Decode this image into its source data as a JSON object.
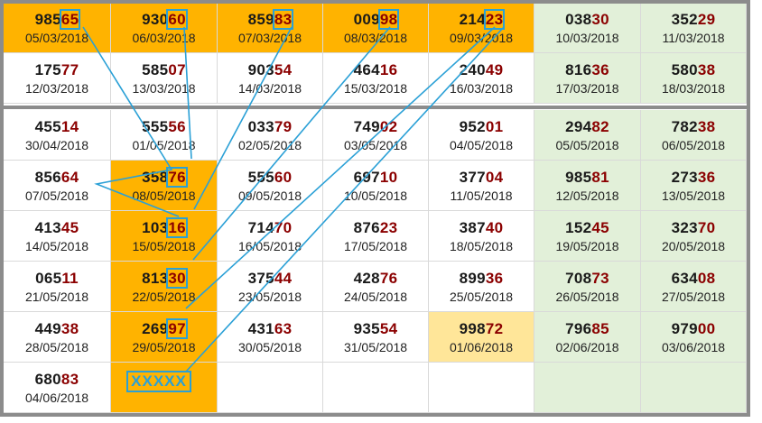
{
  "colors": {
    "orange": "#ffb300",
    "green": "#e2f0d9",
    "cream": "#ffe699",
    "white": "#ffffff",
    "highlight_digits": "#8b0000",
    "connector": "#2aa0d6"
  },
  "placeholder_label": "XXXXX",
  "top_rows": [
    [
      {
        "main": "985",
        "hi": "65",
        "date": "05/03/2018",
        "bg": "orange",
        "boxed": true
      },
      {
        "main": "930",
        "hi": "60",
        "date": "06/03/2018",
        "bg": "orange",
        "boxed": true
      },
      {
        "main": "859",
        "hi": "83",
        "date": "07/03/2018",
        "bg": "orange",
        "boxed": true
      },
      {
        "main": "009",
        "hi": "98",
        "date": "08/03/2018",
        "bg": "orange",
        "boxed": true
      },
      {
        "main": "214",
        "hi": "23",
        "date": "09/03/2018",
        "bg": "orange",
        "boxed": true
      },
      {
        "main": "038",
        "hi": "30",
        "date": "10/03/2018",
        "bg": "green",
        "boxed": false
      },
      {
        "main": "352",
        "hi": "29",
        "date": "11/03/2018",
        "bg": "green",
        "boxed": false
      }
    ],
    [
      {
        "main": "175",
        "hi": "77",
        "date": "12/03/2018",
        "bg": "white",
        "boxed": false
      },
      {
        "main": "585",
        "hi": "07",
        "date": "13/03/2018",
        "bg": "white",
        "boxed": false
      },
      {
        "main": "903",
        "hi": "54",
        "date": "14/03/2018",
        "bg": "white",
        "boxed": false
      },
      {
        "main": "464",
        "hi": "16",
        "date": "15/03/2018",
        "bg": "white",
        "boxed": false
      },
      {
        "main": "240",
        "hi": "49",
        "date": "16/03/2018",
        "bg": "white",
        "boxed": false
      },
      {
        "main": "816",
        "hi": "36",
        "date": "17/03/2018",
        "bg": "green",
        "boxed": false
      },
      {
        "main": "580",
        "hi": "38",
        "date": "18/03/2018",
        "bg": "green",
        "boxed": false
      }
    ]
  ],
  "bottom_rows": [
    [
      {
        "main": "455",
        "hi": "14",
        "date": "30/04/2018",
        "bg": "white",
        "boxed": false
      },
      {
        "main": "555",
        "hi": "56",
        "date": "01/05/2018",
        "bg": "white",
        "boxed": false
      },
      {
        "main": "033",
        "hi": "79",
        "date": "02/05/2018",
        "bg": "white",
        "boxed": false
      },
      {
        "main": "749",
        "hi": "02",
        "date": "03/05/2018",
        "bg": "white",
        "boxed": false
      },
      {
        "main": "952",
        "hi": "01",
        "date": "04/05/2018",
        "bg": "white",
        "boxed": false
      },
      {
        "main": "294",
        "hi": "82",
        "date": "05/05/2018",
        "bg": "green",
        "boxed": false
      },
      {
        "main": "782",
        "hi": "38",
        "date": "06/05/2018",
        "bg": "green",
        "boxed": false
      }
    ],
    [
      {
        "main": "856",
        "hi": "64",
        "date": "07/05/2018",
        "bg": "white",
        "boxed": false
      },
      {
        "main": "358",
        "hi": "76",
        "date": "08/05/2018",
        "bg": "orange",
        "boxed": true
      },
      {
        "main": "555",
        "hi": "60",
        "date": "09/05/2018",
        "bg": "white",
        "boxed": false
      },
      {
        "main": "697",
        "hi": "10",
        "date": "10/05/2018",
        "bg": "white",
        "boxed": false
      },
      {
        "main": "377",
        "hi": "04",
        "date": "11/05/2018",
        "bg": "white",
        "boxed": false
      },
      {
        "main": "985",
        "hi": "81",
        "date": "12/05/2018",
        "bg": "green",
        "boxed": false
      },
      {
        "main": "273",
        "hi": "36",
        "date": "13/05/2018",
        "bg": "green",
        "boxed": false
      }
    ],
    [
      {
        "main": "413",
        "hi": "45",
        "date": "14/05/2018",
        "bg": "white",
        "boxed": false
      },
      {
        "main": "103",
        "hi": "16",
        "date": "15/05/2018",
        "bg": "orange",
        "boxed": true
      },
      {
        "main": "714",
        "hi": "70",
        "date": "16/05/2018",
        "bg": "white",
        "boxed": false
      },
      {
        "main": "876",
        "hi": "23",
        "date": "17/05/2018",
        "bg": "white",
        "boxed": false
      },
      {
        "main": "387",
        "hi": "40",
        "date": "18/05/2018",
        "bg": "white",
        "boxed": false
      },
      {
        "main": "152",
        "hi": "45",
        "date": "19/05/2018",
        "bg": "green",
        "boxed": false
      },
      {
        "main": "323",
        "hi": "70",
        "date": "20/05/2018",
        "bg": "green",
        "boxed": false
      }
    ],
    [
      {
        "main": "065",
        "hi": "11",
        "date": "21/05/2018",
        "bg": "white",
        "boxed": false
      },
      {
        "main": "813",
        "hi": "30",
        "date": "22/05/2018",
        "bg": "orange",
        "boxed": true
      },
      {
        "main": "375",
        "hi": "44",
        "date": "23/05/2018",
        "bg": "white",
        "boxed": false
      },
      {
        "main": "428",
        "hi": "76",
        "date": "24/05/2018",
        "bg": "white",
        "boxed": false
      },
      {
        "main": "899",
        "hi": "36",
        "date": "25/05/2018",
        "bg": "white",
        "boxed": false
      },
      {
        "main": "708",
        "hi": "73",
        "date": "26/05/2018",
        "bg": "green",
        "boxed": false
      },
      {
        "main": "634",
        "hi": "08",
        "date": "27/05/2018",
        "bg": "green",
        "boxed": false
      }
    ],
    [
      {
        "main": "449",
        "hi": "38",
        "date": "28/05/2018",
        "bg": "white",
        "boxed": false
      },
      {
        "main": "269",
        "hi": "97",
        "date": "29/05/2018",
        "bg": "orange",
        "boxed": true
      },
      {
        "main": "431",
        "hi": "63",
        "date": "30/05/2018",
        "bg": "white",
        "boxed": false
      },
      {
        "main": "935",
        "hi": "54",
        "date": "31/05/2018",
        "bg": "white",
        "boxed": false
      },
      {
        "main": "998",
        "hi": "72",
        "date": "01/06/2018",
        "bg": "cream",
        "boxed": false
      },
      {
        "main": "796",
        "hi": "85",
        "date": "02/06/2018",
        "bg": "green",
        "boxed": false
      },
      {
        "main": "979",
        "hi": "00",
        "date": "03/06/2018",
        "bg": "green",
        "boxed": false
      }
    ],
    [
      {
        "main": "680",
        "hi": "83",
        "date": "04/06/2018",
        "bg": "white",
        "boxed": false
      },
      {
        "main": "",
        "hi": "",
        "date": "",
        "bg": "orange",
        "boxed": false
      },
      {
        "main": "",
        "hi": "",
        "date": "",
        "bg": "white",
        "boxed": false
      },
      {
        "main": "",
        "hi": "",
        "date": "",
        "bg": "white",
        "boxed": false
      },
      {
        "main": "",
        "hi": "",
        "date": "",
        "bg": "white",
        "boxed": false
      },
      {
        "main": "",
        "hi": "",
        "date": "",
        "bg": "green",
        "boxed": false
      },
      {
        "main": "",
        "hi": "",
        "date": "",
        "bg": "green",
        "boxed": false
      }
    ]
  ]
}
